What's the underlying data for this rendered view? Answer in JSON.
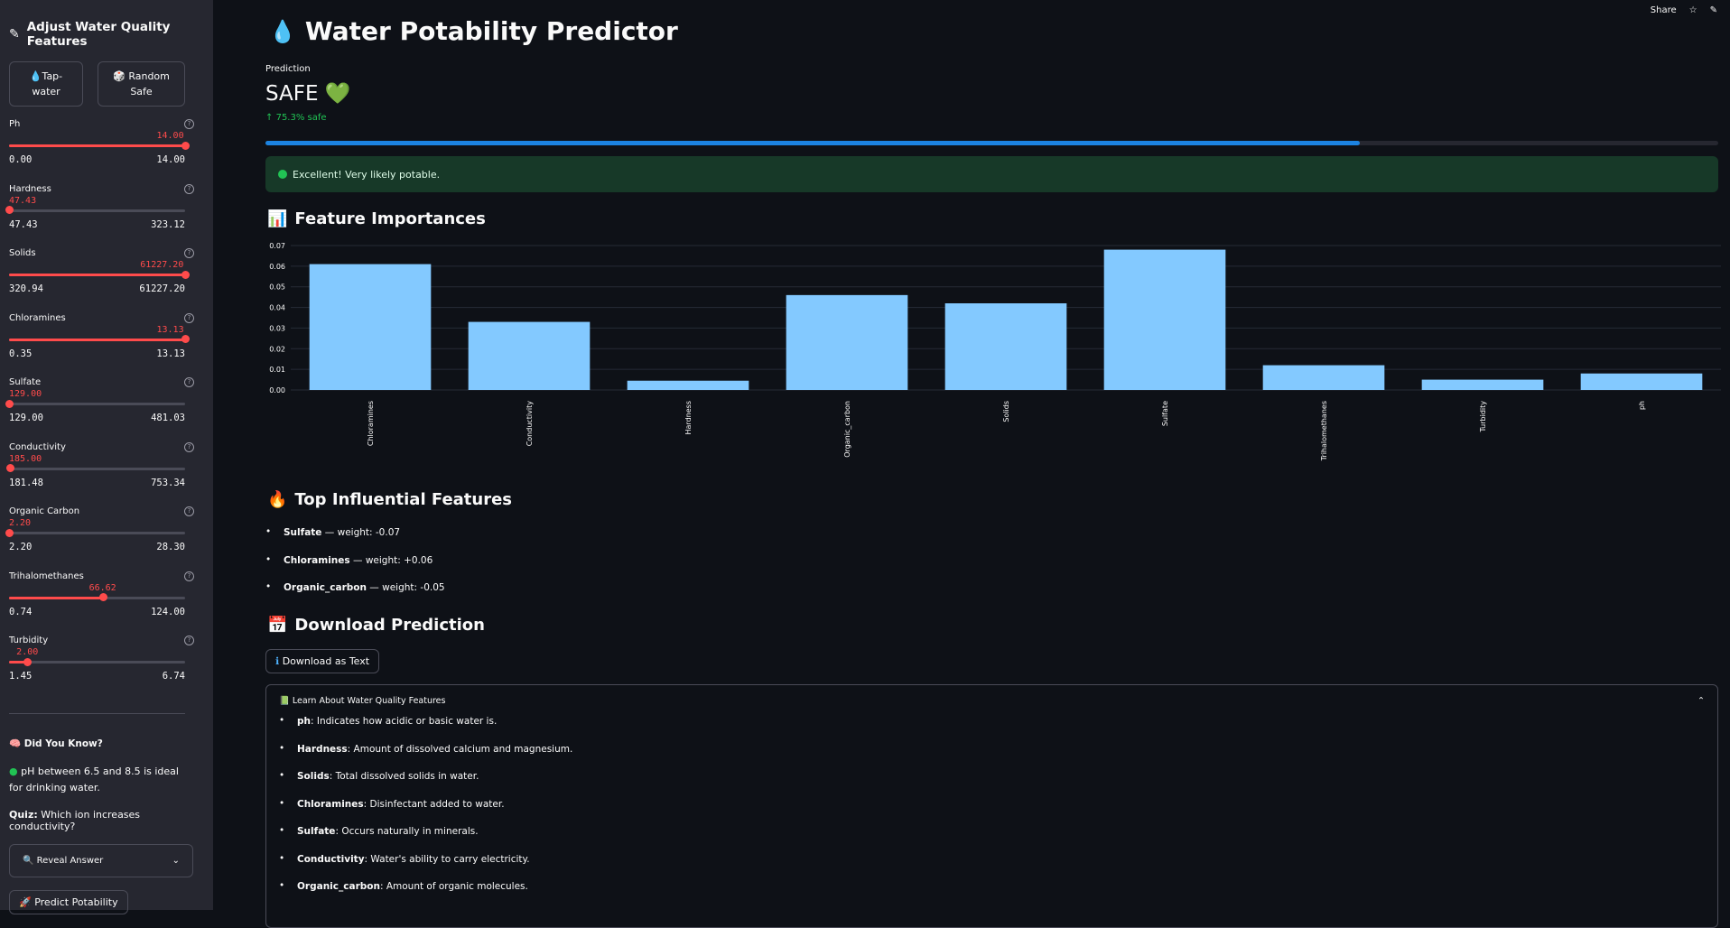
{
  "sidebar": {
    "title": "Adjust Water Quality Features",
    "preset_tap": "Tap-water",
    "preset_random_l1": "Random",
    "preset_random_l2": "Safe",
    "sliders": [
      {
        "label": "Ph",
        "value": "14.00",
        "min": "0.00",
        "max": "14.00",
        "frac": 1.0
      },
      {
        "label": "Hardness",
        "value": "47.43",
        "min": "47.43",
        "max": "323.12",
        "frac": 0.0
      },
      {
        "label": "Solids",
        "value": "61227.20",
        "min": "320.94",
        "max": "61227.20",
        "frac": 1.0
      },
      {
        "label": "Chloramines",
        "value": "13.13",
        "min": "0.35",
        "max": "13.13",
        "frac": 1.0
      },
      {
        "label": "Sulfate",
        "value": "129.00",
        "min": "129.00",
        "max": "481.03",
        "frac": 0.0
      },
      {
        "label": "Conductivity",
        "value": "185.00",
        "min": "181.48",
        "max": "753.34",
        "frac": 0.006
      },
      {
        "label": "Organic Carbon",
        "value": "2.20",
        "min": "2.20",
        "max": "28.30",
        "frac": 0.0
      },
      {
        "label": "Trihalomethanes",
        "value": "66.62",
        "min": "0.74",
        "max": "124.00",
        "frac": 0.534
      },
      {
        "label": "Turbidity",
        "value": "2.00",
        "min": "1.45",
        "max": "6.74",
        "frac": 0.104
      }
    ],
    "did_you_know": "Did You Know?",
    "fact": "pH between 6.5 and 8.5 is ideal for drinking water.",
    "quiz_bold": "Quiz:",
    "quiz_text": "Which ion increases conductivity?",
    "reveal_label": "Reveal Answer",
    "predict_label": "Predict Potability"
  },
  "topbar": {
    "share": "Share"
  },
  "main": {
    "title": "Water Potability Predictor",
    "prediction_label": "Prediction",
    "prediction_value": "SAFE",
    "prediction_delta": "75.3% safe",
    "confidence": 0.753,
    "alert": "Excellent! Very likely potable.",
    "feat_imp_title": "Feature Importances",
    "top_title": "Top Influential Features",
    "top_features": [
      {
        "name": "Sulfate",
        "text": " — weight: -0.07"
      },
      {
        "name": "Chloramines",
        "text": " — weight: +0.06"
      },
      {
        "name": "Organic_carbon",
        "text": " — weight: -0.05"
      }
    ],
    "download_title": "Download Prediction",
    "download_btn": "Download as Text",
    "expander_title": "Learn About Water Quality Features",
    "learn": [
      {
        "name": "ph",
        "text": ": Indicates how acidic or basic water is."
      },
      {
        "name": "Hardness",
        "text": ": Amount of dissolved calcium and magnesium."
      },
      {
        "name": "Solids",
        "text": ": Total dissolved solids in water."
      },
      {
        "name": "Chloramines",
        "text": ": Disinfectant added to water."
      },
      {
        "name": "Sulfate",
        "text": ": Occurs naturally in minerals."
      },
      {
        "name": "Conductivity",
        "text": ": Water's ability to carry electricity."
      },
      {
        "name": "Organic_carbon",
        "text": ": Amount of organic molecules."
      }
    ]
  },
  "chart_data": {
    "type": "bar",
    "categories": [
      "Chloramines",
      "Conductivity",
      "Hardness",
      "Organic_carbon",
      "Solids",
      "Sulfate",
      "Trihalomethanes",
      "Turbidity",
      "ph"
    ],
    "values": [
      0.061,
      0.033,
      0.0045,
      0.046,
      0.042,
      0.068,
      0.012,
      0.005,
      0.008
    ],
    "ylim": [
      0,
      0.07
    ],
    "yticks": [
      "0.00",
      "0.01",
      "0.02",
      "0.03",
      "0.04",
      "0.05",
      "0.06",
      "0.07"
    ],
    "grid": true,
    "color": "#83c9ff"
  },
  "colors": {
    "accent": "#ff4b4b",
    "progress": "#1c83e1",
    "success_bg": "#173928",
    "success": "#21c354"
  }
}
